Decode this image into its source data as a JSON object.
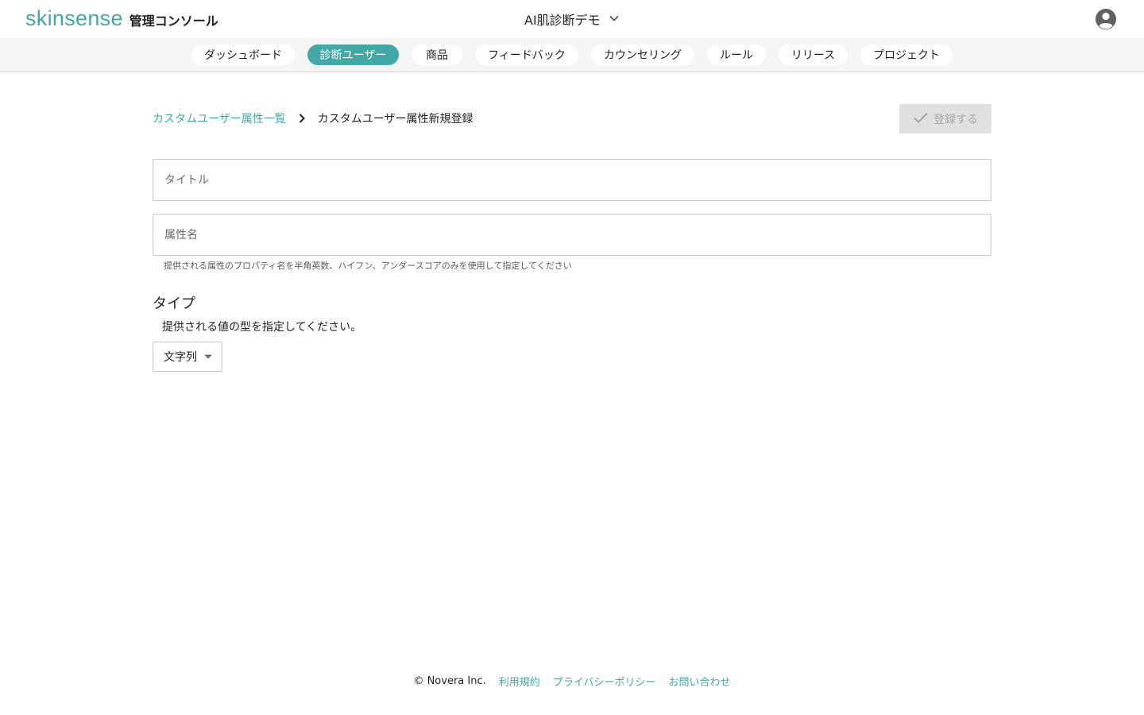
{
  "brand": {
    "logo": "skinsense",
    "subtitle": "管理コンソール",
    "color": "#40a9a6"
  },
  "project": {
    "name": "AI肌診断デモ",
    "dropdown_icon": "chevron-down-icon"
  },
  "user": {
    "avatar_icon": "account-circle-icon"
  },
  "nav": {
    "tabs": [
      {
        "label": "ダッシュボード",
        "active": false
      },
      {
        "label": "診断ユーザー",
        "active": true
      },
      {
        "label": "商品",
        "active": false
      },
      {
        "label": "フィードバック",
        "active": false
      },
      {
        "label": "カウンセリング",
        "active": false
      },
      {
        "label": "ルール",
        "active": false
      },
      {
        "label": "リリース",
        "active": false
      },
      {
        "label": "プロジェクト",
        "active": false
      }
    ]
  },
  "breadcrumb": {
    "parent": "カスタムユーザー属性一覧",
    "separator_icon": "chevron-right-icon",
    "current": "カスタムユーザー属性新規登録"
  },
  "actions": {
    "submit_label": "登録する",
    "submit_icon": "check-icon",
    "submit_disabled": true
  },
  "form": {
    "title": {
      "placeholder": "タイトル",
      "value": ""
    },
    "attribute_name": {
      "placeholder": "属性名",
      "value": "",
      "helper": "提供される属性のプロパティ名を半角英数、ハイフン、アンダースコアのみを使用して指定してください"
    },
    "type": {
      "heading": "タイプ",
      "description": "提供される値の型を指定してください。",
      "selected": "文字列",
      "dropdown_icon": "arrow-drop-down-icon"
    }
  },
  "footer": {
    "copyright": "© Novera Inc.",
    "links": [
      "利用規約",
      "プライバシーポリシー",
      "お問い合わせ"
    ]
  }
}
